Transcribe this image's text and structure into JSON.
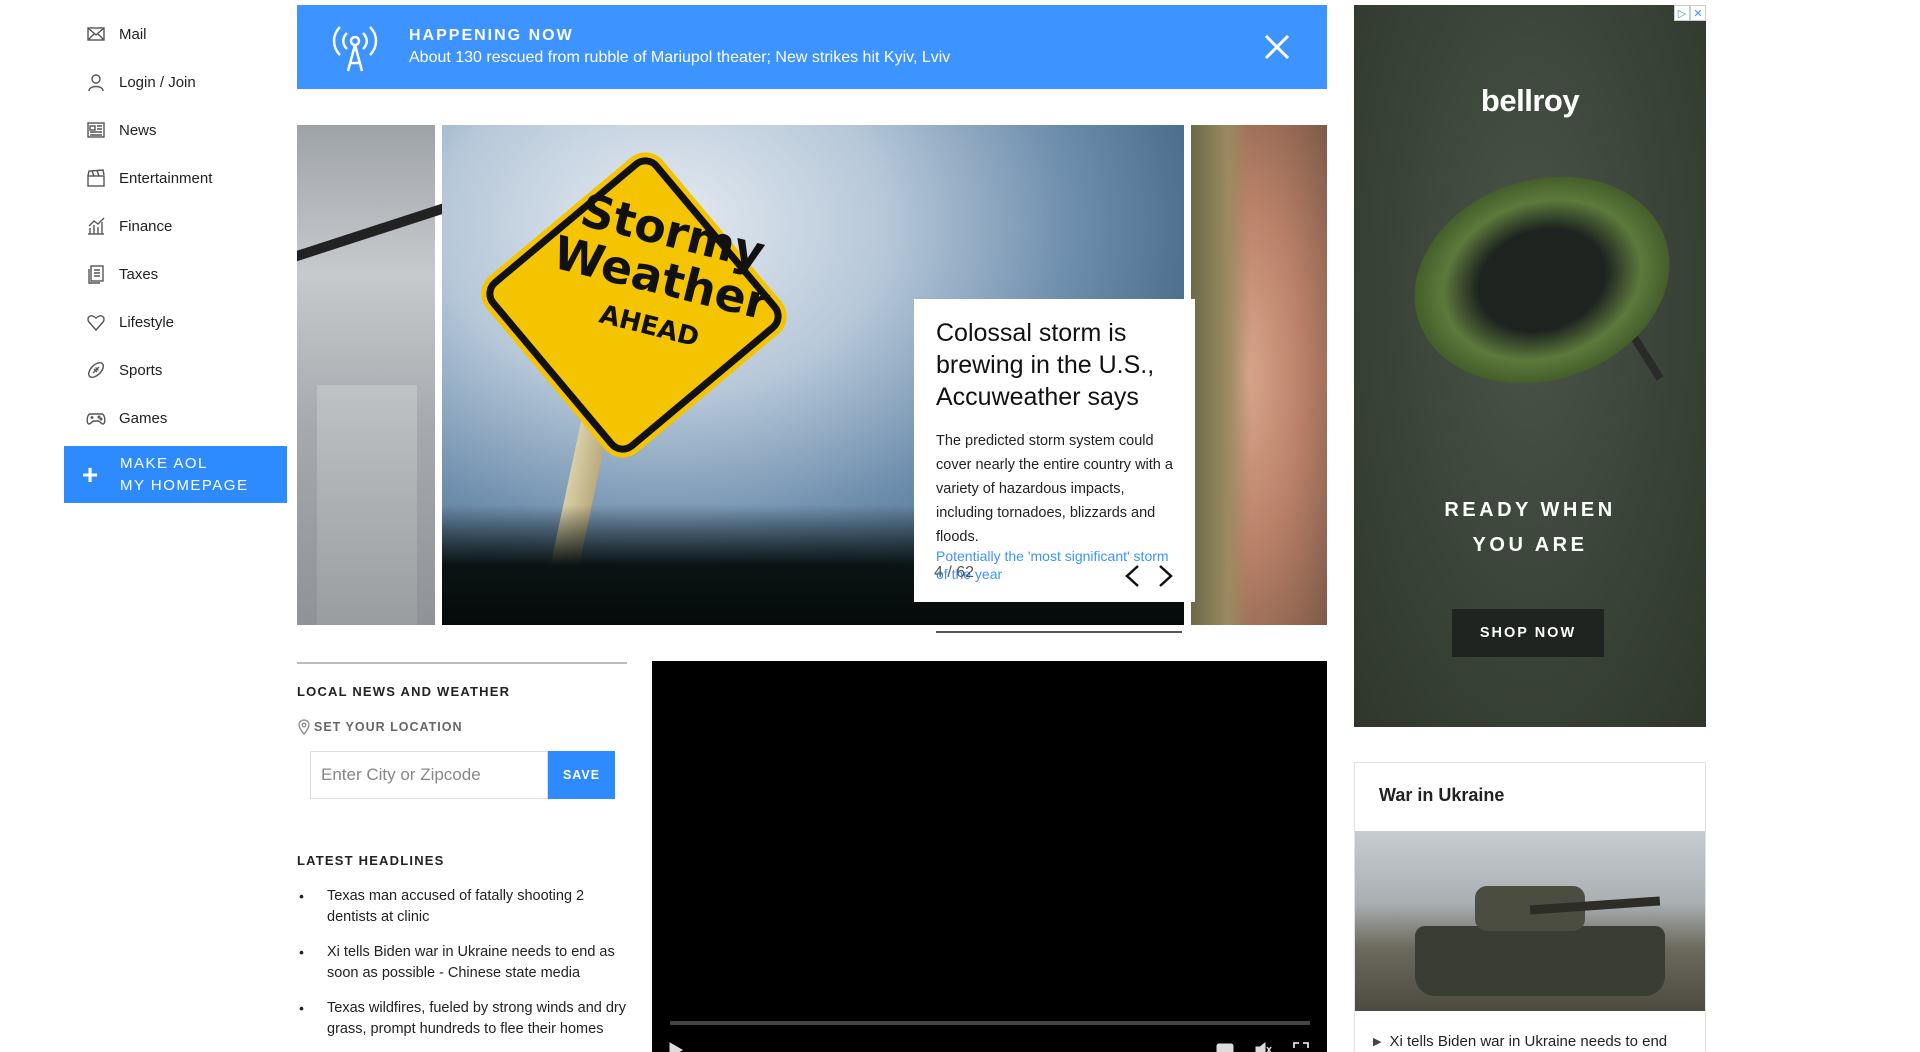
{
  "sidebar": {
    "items": [
      {
        "label": "Mail",
        "icon": "mail-icon"
      },
      {
        "label": "Login / Join",
        "icon": "user-icon"
      },
      {
        "label": "News",
        "icon": "news-icon"
      },
      {
        "label": "Entertainment",
        "icon": "clapperboard-icon"
      },
      {
        "label": "Finance",
        "icon": "chart-icon"
      },
      {
        "label": "Taxes",
        "icon": "document-icon"
      },
      {
        "label": "Lifestyle",
        "icon": "heart-icon"
      },
      {
        "label": "Sports",
        "icon": "football-icon"
      },
      {
        "label": "Games",
        "icon": "gamepad-icon"
      }
    ],
    "make_homepage_line1": "MAKE AOL",
    "make_homepage_line2": "MY HOMEPAGE"
  },
  "banner": {
    "kicker": "HAPPENING NOW",
    "headline": "About 130 rescued from rubble of Mariupol theater; New strikes hit Kyiv, Lviv",
    "bg_color": "#3d93ff"
  },
  "carousel": {
    "sign_line1": "Stormy",
    "sign_line2": "Weather",
    "sign_line3": "AHEAD",
    "title": "Colossal storm is brewing in the U.S., Accuweather says",
    "description": "The predicted storm system could cover nearly the entire country with a variety of hazardous impacts, including tornadoes, blizzards and floods.",
    "link": "Potentially the 'most significant' storm of the year",
    "counter": "4 / 62"
  },
  "local_news": {
    "title": "LOCAL NEWS AND WEATHER",
    "set_location": "SET YOUR LOCATION",
    "input_placeholder": "Enter City or Zipcode",
    "input_value": "",
    "save_label": "SAVE"
  },
  "latest_headlines": {
    "title": "LATEST HEADLINES",
    "items": [
      "Texas man accused of fatally shooting 2 dentists at clinic",
      "Xi tells Biden war in Ukraine needs to end as soon as possible - Chinese state media",
      "Texas wildfires, fueled by strong winds and dry grass, prompt hundreds to flee their homes"
    ]
  },
  "ad": {
    "brand": "bellroy",
    "tagline_line1": "READY WHEN",
    "tagline_line2": "YOU ARE",
    "cta": "SHOP NOW",
    "adchoices_label": "▷",
    "close_label": "✕"
  },
  "ukraine": {
    "title": "War in Ukraine",
    "link": "Xi tells Biden war in Ukraine needs to end"
  },
  "colors": {
    "accent": "#2e8bff",
    "ad_bg": "#394237"
  }
}
